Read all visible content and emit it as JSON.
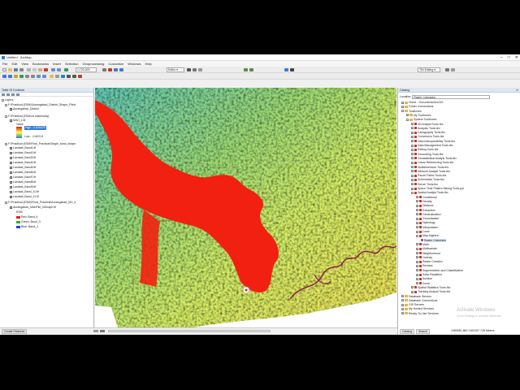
{
  "window": {
    "title": "Untitled - ArcMap",
    "controls": [
      "–",
      "□",
      "✕"
    ]
  },
  "menu": [
    "File",
    "Edit",
    "View",
    "Bookmarks",
    "Insert",
    "Selection",
    "Geoprocessing",
    "Customize",
    "Windows",
    "Help"
  ],
  "toolbar": {
    "scale": "1:720,000",
    "editor_label": "Editor ▾",
    "tin_editing": "TIN Editing ▾"
  },
  "toc": {
    "title": "Table Of Contents",
    "layers_root": "Layers",
    "groups": [
      {
        "path": "F:\\Practical (ESM)\\Aurangabad_District_Shape_Files\\",
        "items": [
          "Aurangabad_District"
        ]
      },
      {
        "path": "F:\\Practical (ESM\\crt waterbody)",
        "items": [
          "SAVI_1.tif",
          "Value",
          "High : 0.625478",
          "Low : -0.60213"
        ]
      },
      {
        "path": "F:\\Practical (ESM\\Final_Practical\\Single_band_shape",
        "items": [
          "Landsat_Band1.tif",
          "Landsat_Band2.tif",
          "Landsat_Band3.tif",
          "Landsat_Band4.tif",
          "Landsat_Band5.tif",
          "Landsat_Band6.tif",
          "Landsat_Band7.tif",
          "Landsat_Band8.tif",
          "Landsat_Band9.tif",
          "Landsat_Band_10.tif",
          "Landsat_Band_11.tif"
        ]
      },
      {
        "path": "F:\\Practical (ESM)\\Final_Practical\\Aurangabad_MX_e",
        "items": [
          "Aurangabad_MainFile_inShape.tif",
          "RGB",
          "Red:   Band_4",
          "Green: Band_3",
          "Blue:  Band_2"
        ]
      }
    ]
  },
  "catalog": {
    "title": "Catalog",
    "location_label": "Location:",
    "location_value": "Raster Calculator",
    "rows": [
      {
        "text": "Home - Documents\\ArcGIS",
        "level": 0,
        "kind": "folder",
        "pm": "+"
      },
      {
        "text": "Folder Connections",
        "level": 0,
        "kind": "folder",
        "pm": "+"
      },
      {
        "text": "Toolboxes",
        "level": 0,
        "kind": "folder",
        "pm": "-"
      },
      {
        "text": "My Toolboxes",
        "level": 1,
        "kind": "folder",
        "pm": "+"
      },
      {
        "text": "System Toolboxes",
        "level": 1,
        "kind": "folder",
        "pm": "-"
      },
      {
        "text": "3D Analyst Tools.tbx",
        "level": 2,
        "kind": "tbx",
        "pm": "+"
      },
      {
        "text": "Analysis Tools.tbx",
        "level": 2,
        "kind": "tbx",
        "pm": "+"
      },
      {
        "text": "Cartography Tools.tbx",
        "level": 2,
        "kind": "tbx",
        "pm": "+"
      },
      {
        "text": "Conversion Tools.tbx",
        "level": 2,
        "kind": "tbx",
        "pm": "+"
      },
      {
        "text": "Data Interoperability Tools.tbx",
        "level": 2,
        "kind": "tbx",
        "pm": "+"
      },
      {
        "text": "Data Management Tools.tbx",
        "level": 2,
        "kind": "tbx",
        "pm": "+"
      },
      {
        "text": "Editing Tools.tbx",
        "level": 2,
        "kind": "tbx",
        "pm": "+"
      },
      {
        "text": "Geocoding Tools.tbx",
        "level": 2,
        "kind": "tbx",
        "pm": "+"
      },
      {
        "text": "Geostatistical Analyst Tools.tbx",
        "level": 2,
        "kind": "tbx",
        "pm": "+"
      },
      {
        "text": "Linear Referencing Tools.tbx",
        "level": 2,
        "kind": "tbx",
        "pm": "+"
      },
      {
        "text": "Multidimension Tools.tbx",
        "level": 2,
        "kind": "tbx",
        "pm": "+"
      },
      {
        "text": "Network Analyst Tools.tbx",
        "level": 2,
        "kind": "tbx",
        "pm": "+"
      },
      {
        "text": "Parcel Fabric Tools.tbx",
        "level": 2,
        "kind": "tbx",
        "pm": "+"
      },
      {
        "text": "Schematics Tools.tbx",
        "level": 2,
        "kind": "tbx",
        "pm": "+"
      },
      {
        "text": "Server Tools.tbx",
        "level": 2,
        "kind": "tbx",
        "pm": "+"
      },
      {
        "text": "Space Time Pattern Mining Tools.pyt",
        "level": 2,
        "kind": "tbx",
        "pm": "+"
      },
      {
        "text": "Spatial Analyst Tools.tbx",
        "level": 2,
        "kind": "tbx",
        "pm": "-"
      },
      {
        "text": "Conditional",
        "level": 3,
        "kind": "tbx",
        "pm": "+"
      },
      {
        "text": "Density",
        "level": 3,
        "kind": "tbx",
        "pm": "+"
      },
      {
        "text": "Distance",
        "level": 3,
        "kind": "tbx",
        "pm": "+"
      },
      {
        "text": "Extraction",
        "level": 3,
        "kind": "tbx",
        "pm": "+"
      },
      {
        "text": "Generalization",
        "level": 3,
        "kind": "tbx",
        "pm": "+"
      },
      {
        "text": "Groundwater",
        "level": 3,
        "kind": "tbx",
        "pm": "+"
      },
      {
        "text": "Hydrology",
        "level": 3,
        "kind": "tbx",
        "pm": "+"
      },
      {
        "text": "Interpolation",
        "level": 3,
        "kind": "tbx",
        "pm": "+"
      },
      {
        "text": "Local",
        "level": 3,
        "kind": "tbx",
        "pm": "+"
      },
      {
        "text": "Map Algebra",
        "level": 3,
        "kind": "tbx",
        "pm": "-"
      },
      {
        "text": "Raster Calculator",
        "level": 4,
        "kind": "tool",
        "pm": ""
      },
      {
        "text": "Math",
        "level": 3,
        "kind": "tbx",
        "pm": "+"
      },
      {
        "text": "Multivariate",
        "level": 3,
        "kind": "tbx",
        "pm": "+"
      },
      {
        "text": "Neighborhood",
        "level": 3,
        "kind": "tbx",
        "pm": "+"
      },
      {
        "text": "Overlay",
        "level": 3,
        "kind": "tbx",
        "pm": "+"
      },
      {
        "text": "Raster Creation",
        "level": 3,
        "kind": "tbx",
        "pm": "+"
      },
      {
        "text": "Reclass",
        "level": 3,
        "kind": "tbx",
        "pm": "+"
      },
      {
        "text": "Segmentation and Classification",
        "level": 3,
        "kind": "tbx",
        "pm": "+"
      },
      {
        "text": "Solar Radiation",
        "level": 3,
        "kind": "tbx",
        "pm": "+"
      },
      {
        "text": "Surface",
        "level": 3,
        "kind": "tbx",
        "pm": "+"
      },
      {
        "text": "Zonal",
        "level": 3,
        "kind": "tbx",
        "pm": "+"
      },
      {
        "text": "Spatial Statistics Tools.tbx",
        "level": 2,
        "kind": "tbx",
        "pm": "+"
      },
      {
        "text": "Tracking Analyst Tools.tbx",
        "level": 2,
        "kind": "tbx",
        "pm": "+"
      },
      {
        "text": "Database Servers",
        "level": 0,
        "kind": "folder",
        "pm": "+"
      },
      {
        "text": "Database Connections",
        "level": 0,
        "kind": "folder",
        "pm": "+"
      },
      {
        "text": "GIS Servers",
        "level": 0,
        "kind": "folder",
        "pm": "+"
      },
      {
        "text": "My Hosted Services",
        "level": 0,
        "kind": "folder",
        "pm": "+"
      },
      {
        "text": "Ready-To-Use Services",
        "level": 0,
        "kind": "folder",
        "pm": "+"
      }
    ],
    "tabs": [
      "Catalog",
      "Search"
    ]
  },
  "status": {
    "create_features": "Create Features",
    "coordinates": "1980651.882  2163157.728 Meters"
  },
  "watermark": {
    "line1": "Activate Windows",
    "line2": "Go to Settings to activate Windows."
  },
  "colors": {
    "water": "#f22010",
    "high": "#d7191c",
    "mid": "#ffff40",
    "low": "#2b83ba",
    "river": "#8b1a4a"
  }
}
